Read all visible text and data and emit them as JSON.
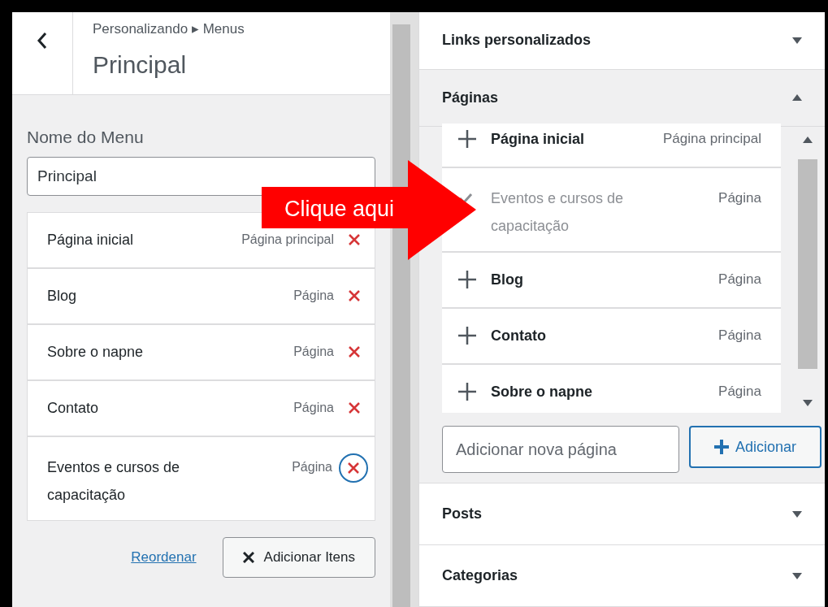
{
  "header": {
    "breadcrumb": "Personalizando ▸ Menus",
    "title": "Principal"
  },
  "menu_name": {
    "label": "Nome do Menu",
    "value": "Principal"
  },
  "menu_items": [
    {
      "label": "Página inicial",
      "type": "Página principal",
      "focused": false
    },
    {
      "label": "Blog",
      "type": "Página",
      "focused": false
    },
    {
      "label": "Sobre o napne",
      "type": "Página",
      "focused": false
    },
    {
      "label": "Contato",
      "type": "Página",
      "focused": false
    },
    {
      "label": "Eventos e cursos de capacitação",
      "type": "Página",
      "focused": true
    }
  ],
  "reorder_link": "Reordenar",
  "add_items_button": "Adicionar Itens",
  "sections_top": [
    {
      "title": "Links personalizados",
      "expanded": false
    },
    {
      "title": "Páginas",
      "expanded": true
    }
  ],
  "pages": [
    {
      "label": "Página inicial",
      "type": "Página principal",
      "added": false
    },
    {
      "label": "Eventos e cursos de capacitação",
      "type": "Página",
      "added": true
    },
    {
      "label": "Blog",
      "type": "Página",
      "added": false
    },
    {
      "label": "Contato",
      "type": "Página",
      "added": false
    },
    {
      "label": "Sobre o napne",
      "type": "Página",
      "added": false
    }
  ],
  "new_page": {
    "placeholder": "Adicionar nova página"
  },
  "add_button": "Adicionar",
  "sections_bottom": [
    {
      "title": "Posts",
      "expanded": false
    },
    {
      "title": "Categorias",
      "expanded": false
    }
  ],
  "callout": "Clique aqui"
}
